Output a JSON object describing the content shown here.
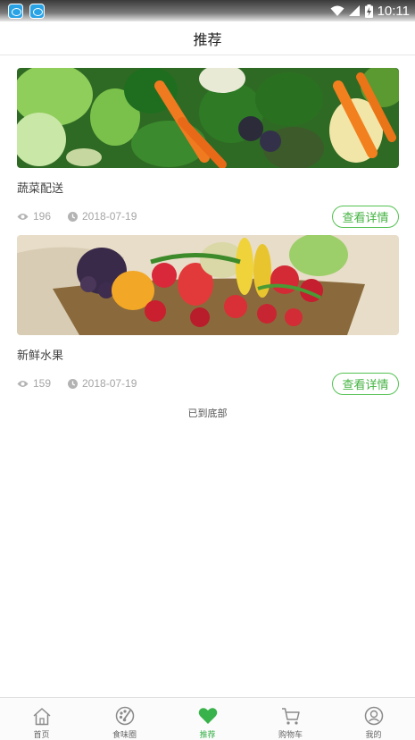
{
  "status_bar": {
    "time": "10:11"
  },
  "header": {
    "title": "推荐"
  },
  "feed": {
    "items": [
      {
        "title": "蔬菜配送",
        "views": "196",
        "date": "2018-07-19",
        "button_label": "查看详情",
        "image": "vegetables-photo"
      },
      {
        "title": "新鲜水果",
        "views": "159",
        "date": "2018-07-19",
        "button_label": "查看详情",
        "image": "fruit-basket-photo"
      }
    ],
    "end_text": "已到底部"
  },
  "tab_bar": {
    "tabs": [
      {
        "label": "首页",
        "icon": "home-icon"
      },
      {
        "label": "食味圈",
        "icon": "palette-icon"
      },
      {
        "label": "推荐",
        "icon": "heart-icon",
        "active": true
      },
      {
        "label": "购物车",
        "icon": "cart-icon"
      },
      {
        "label": "我的",
        "icon": "profile-icon"
      }
    ]
  },
  "colors": {
    "accent": "#43b341",
    "meta_gray": "#a5a5a5"
  }
}
